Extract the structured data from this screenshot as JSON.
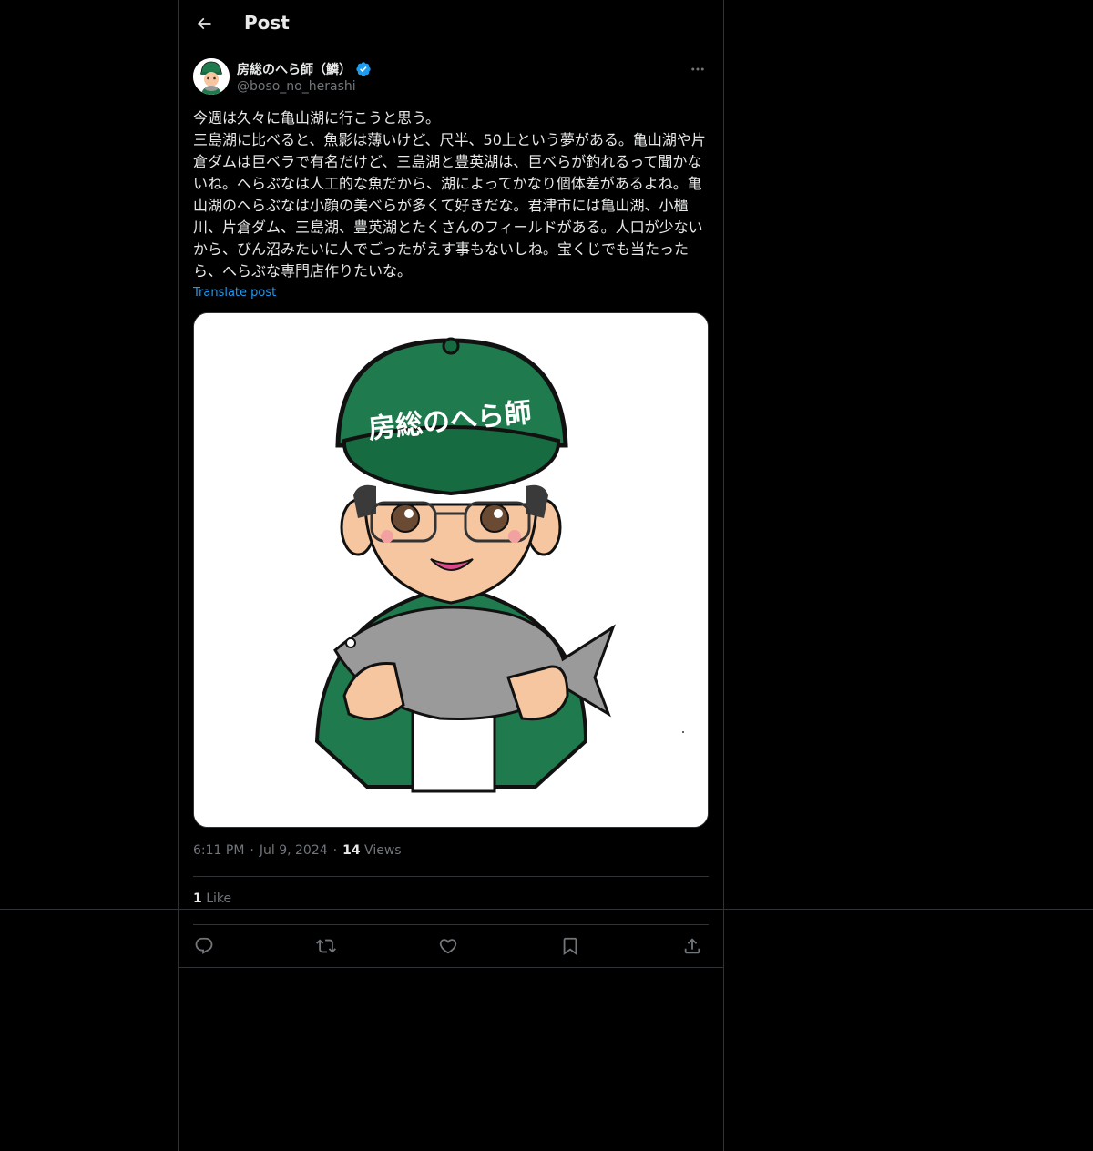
{
  "header": {
    "title": "Post",
    "back_icon": "arrow-left-icon"
  },
  "author": {
    "display_name": "房総のへら師（鱗）",
    "handle": "@boso_no_herashi",
    "verified": true,
    "verified_color": "#1d9bf0"
  },
  "post": {
    "text": "今週は久々に亀山湖に行こうと思う。\n三島湖に比べると、魚影は薄いけど、尺半、50上という夢がある。亀山湖や片倉ダムは巨ベラで有名だけど、三島湖と豊英湖は、巨べらが釣れるって聞かないね。へらぶなは人工的な魚だから、湖によってかなり個体差があるよね。亀山湖のへらぶなは小顔の美べらが多くて好きだな。君津市には亀山湖、小櫃川、片倉ダム、三島湖、豊英湖とたくさんのフィールドがある。人口が少ないから、びん沼みたいに人でごったがえす事もないしね。宝くじでも当たったら、へらぶな専門店作りたいな。",
    "translate_label": "Translate post",
    "media_cap_text": "房総のへら師",
    "time": "6:11 PM",
    "date": "Jul 9, 2024",
    "views_count": "14",
    "views_label": "Views",
    "likes_count": "1",
    "likes_label": "Like"
  },
  "actions": [
    "reply-icon",
    "repost-icon",
    "like-icon",
    "bookmark-icon",
    "share-icon"
  ],
  "colors": {
    "background": "#000000",
    "border": "#2f3336",
    "text_primary": "#e7e9ea",
    "text_secondary": "#71767b",
    "accent": "#1d9bf0",
    "cap_green": "#1f7a4d"
  }
}
